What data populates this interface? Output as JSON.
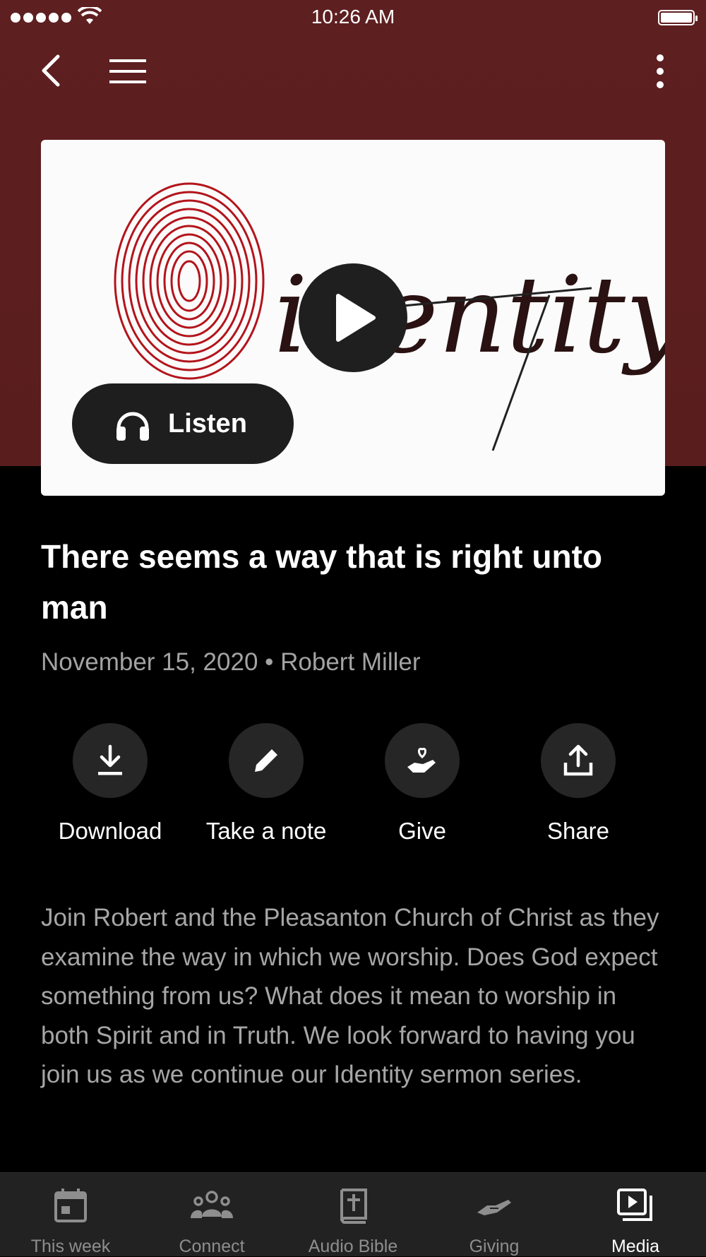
{
  "status_bar": {
    "time": "10:26 AM"
  },
  "colors": {
    "hero_background": "#5e1f20",
    "page_background": "#000000",
    "tab_bar": "#222222",
    "artwork_accent": "#b3141b"
  },
  "nav": {
    "back_icon": "chevron-left-icon",
    "menu_icon": "hamburger-menu-icon",
    "more_icon": "more-vertical-icon"
  },
  "artwork": {
    "word": "identity",
    "play_icon": "play-icon"
  },
  "listen": {
    "label": "Listen",
    "icon": "headphones-icon"
  },
  "sermon": {
    "title": "There seems a way that is right unto man",
    "meta": "November 15, 2020 • Robert Miller",
    "description": "Join Robert and the Pleasanton Church of Christ as they examine the way in which we worship. Does God expect something from us? What does it mean to worship in both Spirit and in Truth. We look forward to having you join us as we continue our Identity sermon series."
  },
  "actions": [
    {
      "label": "Download",
      "icon": "download-icon"
    },
    {
      "label": "Take a note",
      "icon": "pencil-icon"
    },
    {
      "label": "Give",
      "icon": "hand-heart-icon"
    },
    {
      "label": "Share",
      "icon": "share-icon"
    }
  ],
  "tabs": [
    {
      "label": "This week",
      "icon": "calendar-icon",
      "active": false
    },
    {
      "label": "Connect",
      "icon": "people-icon",
      "active": false
    },
    {
      "label": "Audio Bible",
      "icon": "bible-icon",
      "active": false
    },
    {
      "label": "Giving",
      "icon": "giving-hand-icon",
      "active": false
    },
    {
      "label": "Media",
      "icon": "media-icon",
      "active": true
    }
  ]
}
